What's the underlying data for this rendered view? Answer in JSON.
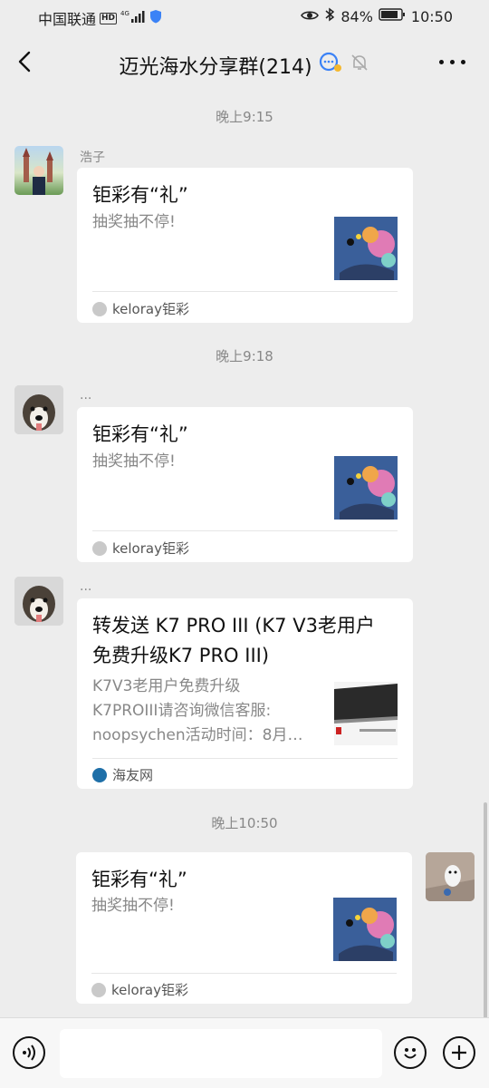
{
  "status_bar": {
    "carrier": "中国联通",
    "network_badge": "HD",
    "network_type": "4G",
    "battery_percent": "84%",
    "time": "10:50"
  },
  "header": {
    "title": "迈光海水分享群(214)",
    "back_icon": "chevron-left-icon",
    "more_icon": "more-dots-icon"
  },
  "messages": [
    {
      "time": "晚上9:15",
      "sender": "浩子",
      "title": "钜彩有“礼”",
      "description": "抽奖抽不停!",
      "source": "keloray钜彩"
    },
    {
      "time": "晚上9:18",
      "sender": "...",
      "title": "钜彩有“礼”",
      "description": "抽奖抽不停!",
      "source": "keloray钜彩"
    },
    {
      "sender": "...",
      "title_line1": "转发送 K7 PRO III (K7 V3老用户",
      "title_line2": "免费升级K7 PRO III)",
      "desc_line1": "K7V3老用户免费升级",
      "desc_line2": "K7PROIII请咨询微信客服:",
      "desc_line3": "noopsychen活动时间：8月…",
      "source": "海友网"
    },
    {
      "time": "晚上10:50",
      "title": "钜彩有“礼”",
      "description": "抽奖抽不停!",
      "source": "keloray钜彩"
    }
  ],
  "input_bar": {
    "voice_icon": "voice-icon",
    "emoji_icon": "emoji-icon",
    "add_icon": "plus-icon",
    "message_value": ""
  },
  "colors": {
    "background": "#ededed",
    "card": "#ffffff",
    "muted_text": "#888888",
    "thumb_blue": "#3a5f9a"
  }
}
